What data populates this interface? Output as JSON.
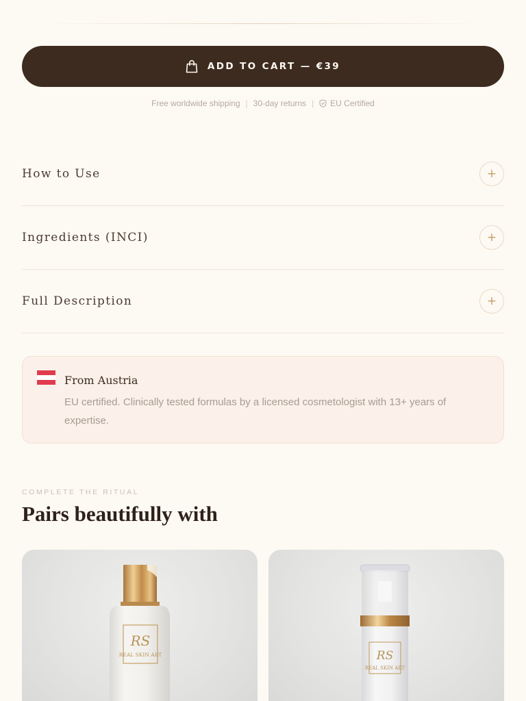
{
  "cart": {
    "label": "ADD TO CART — €39",
    "icon": "shopping-bag-icon"
  },
  "trust": {
    "items": [
      "Free worldwide shipping",
      "30-day returns",
      "EU Certified"
    ],
    "certified_icon": "shield-icon"
  },
  "accordion": {
    "items": [
      {
        "title": "How to Use",
        "toggle": "+"
      },
      {
        "title": "Ingredients (INCI)",
        "toggle": "+"
      },
      {
        "title": "Full Description",
        "toggle": "+"
      }
    ]
  },
  "origin": {
    "title": "From Austria",
    "text": "EU certified. Clinically tested formulas by a licensed cosmetologist with 13+ years of expertise.",
    "flag_icon": "austria-flag-icon"
  },
  "related": {
    "eyebrow": "COMPLETE THE RITUAL",
    "title": "Pairs beautifully with",
    "products": [
      {
        "image": "white-bottle-gold-cap-product-image",
        "logo_text": "REAL SKIN ART"
      },
      {
        "image": "airless-pump-bottle-product-image",
        "logo_text": "REAL SKIN ART"
      }
    ]
  },
  "colors": {
    "background": "#fdf9f3",
    "button": "#3d2b1f",
    "accent_gold": "#c1a063",
    "origin_card": "#fbf1ea"
  }
}
